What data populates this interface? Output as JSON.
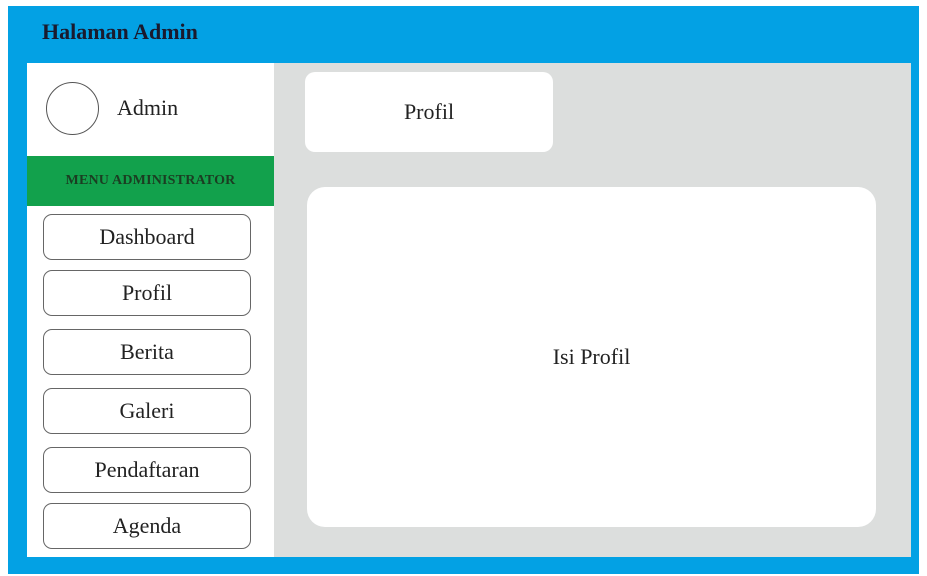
{
  "app": {
    "title": "Halaman Admin"
  },
  "sidebar": {
    "user_name": "Admin",
    "menu_header": "MENU ADMINISTRATOR",
    "items": [
      {
        "label": "Dashboard"
      },
      {
        "label": "Profil"
      },
      {
        "label": "Berita"
      },
      {
        "label": "Galeri"
      },
      {
        "label": "Pendaftaran"
      },
      {
        "label": "Agenda"
      }
    ]
  },
  "main": {
    "page_title": "Profil",
    "content_text": "Isi Profil"
  },
  "colors": {
    "frame": "#03a1e4",
    "menu_header": "#12a14c",
    "content_bg": "#dcdedd",
    "panel": "#ffffff"
  }
}
